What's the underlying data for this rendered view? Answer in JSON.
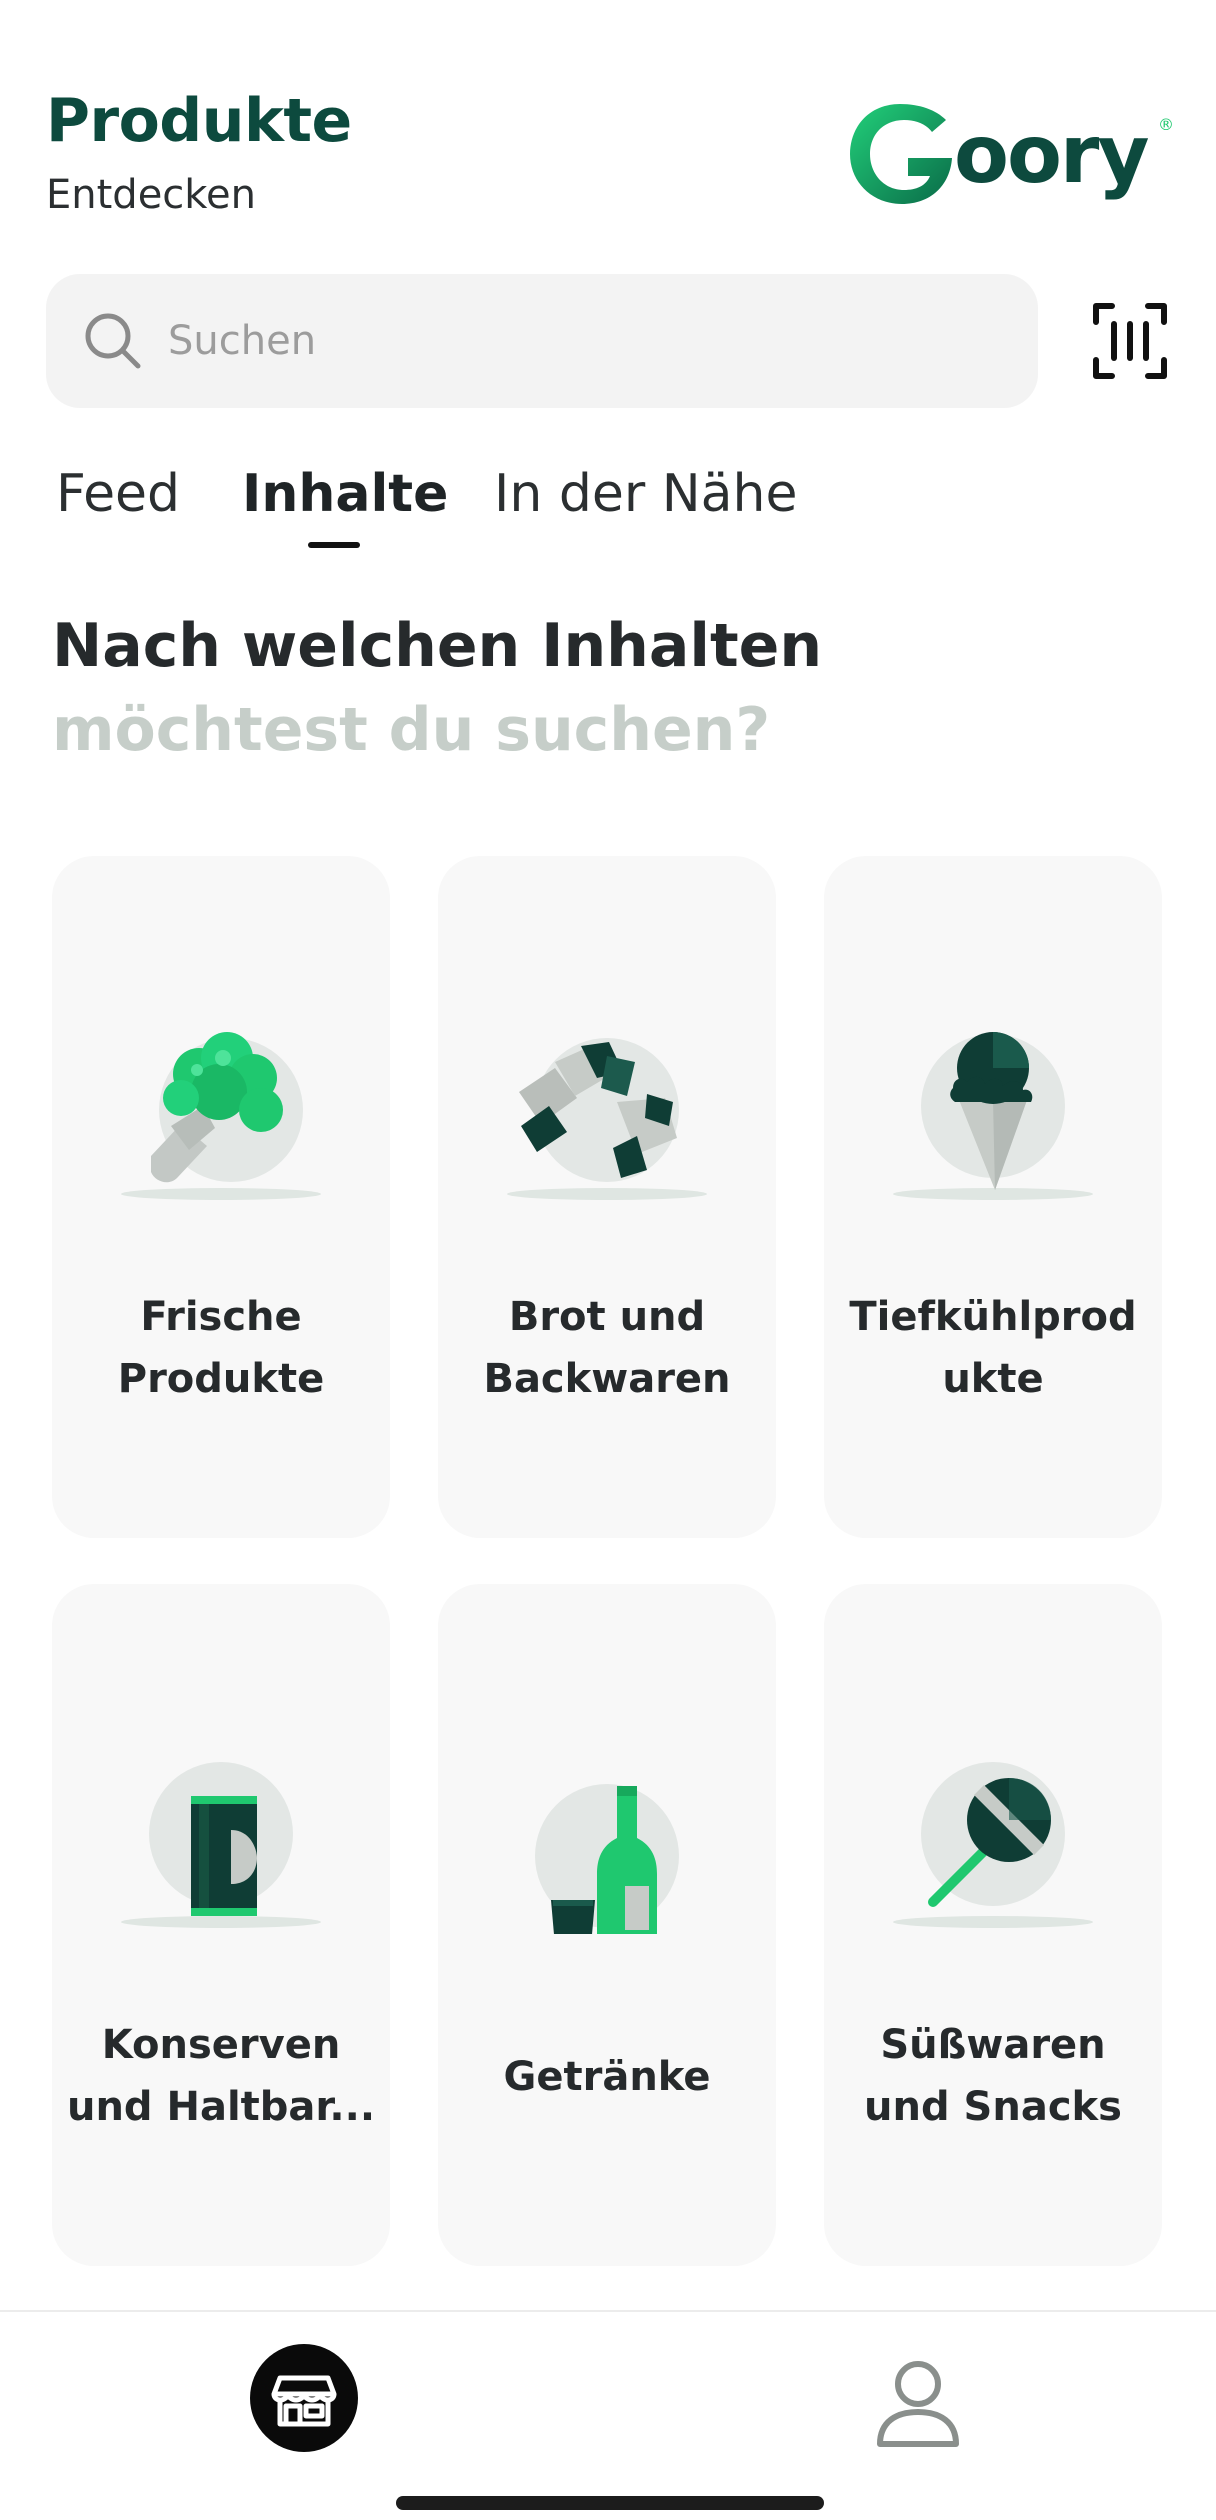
{
  "header": {
    "title": "Produkte",
    "subtitle": "Entdecken",
    "logo_text": "Goory",
    "logo_mark": "®"
  },
  "search": {
    "placeholder": "Suchen",
    "value": ""
  },
  "tabs": [
    {
      "label": "Feed",
      "active": false
    },
    {
      "label": "Inhalte",
      "active": true
    },
    {
      "label": "In der Nähe",
      "active": false
    }
  ],
  "headline": {
    "line1": "Nach welchen Inhalten",
    "line2": "möchtest du suchen?"
  },
  "categories": [
    {
      "label_line1": "Frische",
      "label_line2": "Produkte",
      "icon": "broccoli-icon"
    },
    {
      "label_line1": "Brot und",
      "label_line2": "Backwaren",
      "icon": "croissant-icon"
    },
    {
      "label_line1": "Tiefkühlprod",
      "label_line2": "ukte",
      "icon": "ice-cream-icon"
    },
    {
      "label_line1": "Konserven",
      "label_line2": "und Haltbar...",
      "icon": "can-icon"
    },
    {
      "label_line1": "Getränke",
      "label_line2": "",
      "icon": "bottle-icon"
    },
    {
      "label_line1": "Süßwaren",
      "label_line2": "und Snacks",
      "icon": "lollipop-icon"
    }
  ],
  "bottom_nav": {
    "items": [
      {
        "icon": "store-icon",
        "active": true
      },
      {
        "icon": "profile-icon",
        "active": false
      }
    ]
  },
  "colors": {
    "brand_dark": "#0d4a3e",
    "brand_green": "#1fc86f",
    "headline_muted": "#c6cec9",
    "card_bg": "#f8f8f8"
  }
}
